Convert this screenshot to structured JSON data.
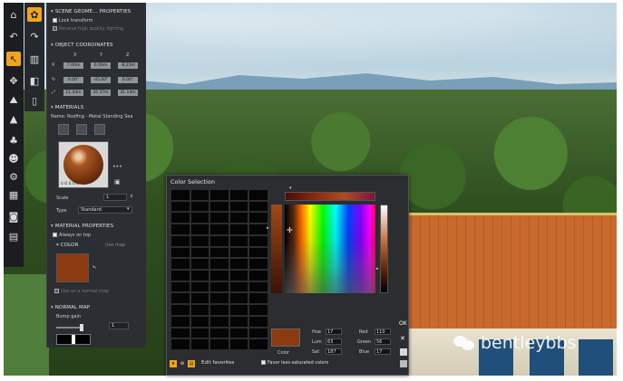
{
  "scene_panel": {
    "section_scene": "SCENE GEOME... PROPERTIES",
    "lock_transform": "Lock transform",
    "receive_lighting": "Receive high quality lighting",
    "section_coords": "OBJECT COORDINATES",
    "axes": [
      "X",
      "Y",
      "Z"
    ],
    "coord_rows": [
      [
        "7.00m",
        "0.00m",
        "-8.23m"
      ],
      [
        "0.00°",
        "-45.00°",
        "0.00°"
      ],
      [
        "11.44m",
        "35.37m",
        "31.14m"
      ]
    ]
  },
  "materials": {
    "section": "MATERIALS",
    "name_label": "Name:",
    "name_value": "Roofing - Metal Standing Sea",
    "more": "•••",
    "preview_text": "¤ 0 0 0 0",
    "scale_label": "Scale",
    "scale_value": "1",
    "type_label": "Type",
    "type_value": "Standard"
  },
  "material_properties": {
    "section": "MATERIAL PROPERTIES",
    "always_on_top": "Always on top",
    "color_section": "COLOR",
    "use_map": "Use map",
    "use_as_normal_map": "Use as a normal map",
    "normal_section": "NORMAL MAP",
    "bump_gain": "Bump gain",
    "bump_value": "1"
  },
  "color_dialog": {
    "title": "Color Selection",
    "ok_label": "OK",
    "close_label": "✕",
    "swatch_label": "Color",
    "hue_label": "Hue",
    "hue_value": "17",
    "lum_label": "Lum",
    "lum_value": "63",
    "sat_label": "Sat",
    "sat_value": "187",
    "red_label": "Red",
    "red_value": "110",
    "green_label": "Green",
    "green_value": "56",
    "blue_label": "Blue",
    "blue_value": "17",
    "edit_favorites": "Edit favorites",
    "favor_less_saturated": "Favor less-saturated colors",
    "current_color": "#8c3a10"
  },
  "watermark": {
    "text": "bentleybbs"
  }
}
